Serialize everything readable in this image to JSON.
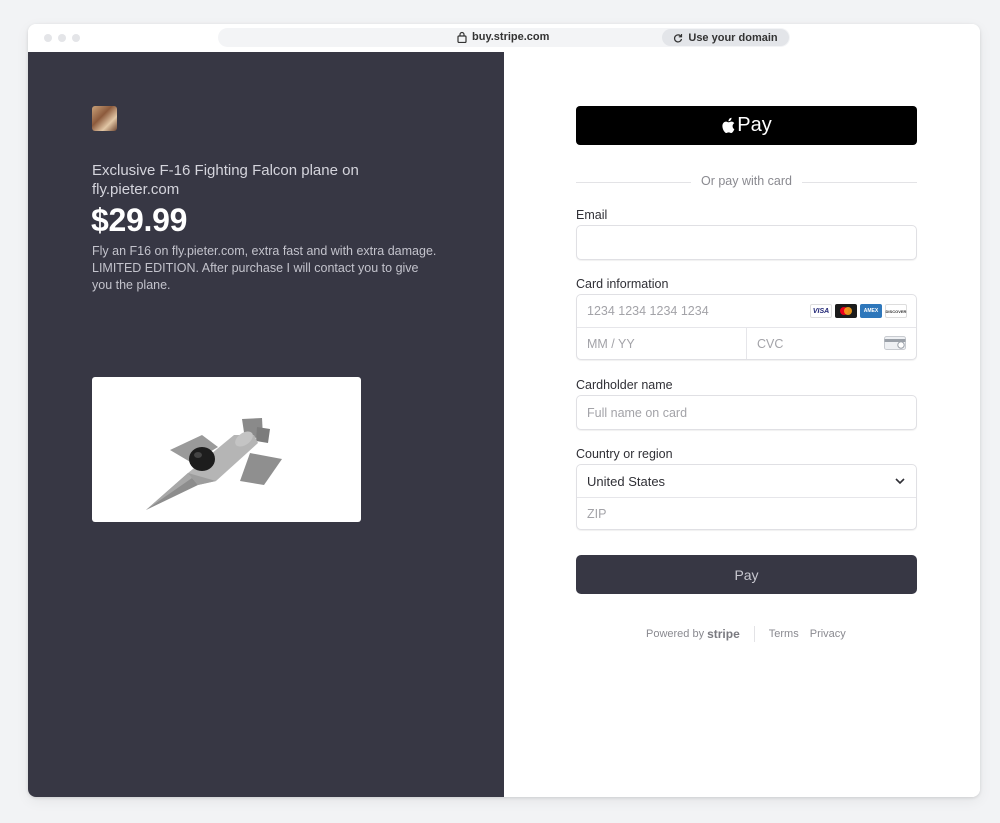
{
  "browser": {
    "url": "buy.stripe.com",
    "domain_button": "Use your domain"
  },
  "product": {
    "name": "Exclusive F-16 Fighting Falcon plane on fly.pieter.com",
    "price": "$29.99",
    "description": "Fly an F16 on fly.pieter.com, extra fast and with extra damage. LIMITED EDITION. After purchase I will contact you to give you the plane."
  },
  "payment": {
    "apple_pay_label": "Pay",
    "divider_text": "Or pay with card",
    "email_label": "Email",
    "email_value": "",
    "card_label": "Card information",
    "card_number_placeholder": "1234 1234 1234 1234",
    "expiry_placeholder": "MM / YY",
    "cvc_placeholder": "CVC",
    "card_brands": [
      "VISA",
      "mastercard",
      "AMEX",
      "DISCOVER"
    ],
    "cardholder_label": "Cardholder name",
    "cardholder_placeholder": "Full name on card",
    "country_label": "Country or region",
    "country_value": "United States",
    "zip_placeholder": "ZIP",
    "pay_button": "Pay"
  },
  "footer": {
    "powered_by": "Powered by",
    "brand": "stripe",
    "terms": "Terms",
    "privacy": "Privacy"
  },
  "colors": {
    "left_panel": "#373744",
    "pay_button": "#373744",
    "apple_pay": "#000000"
  }
}
